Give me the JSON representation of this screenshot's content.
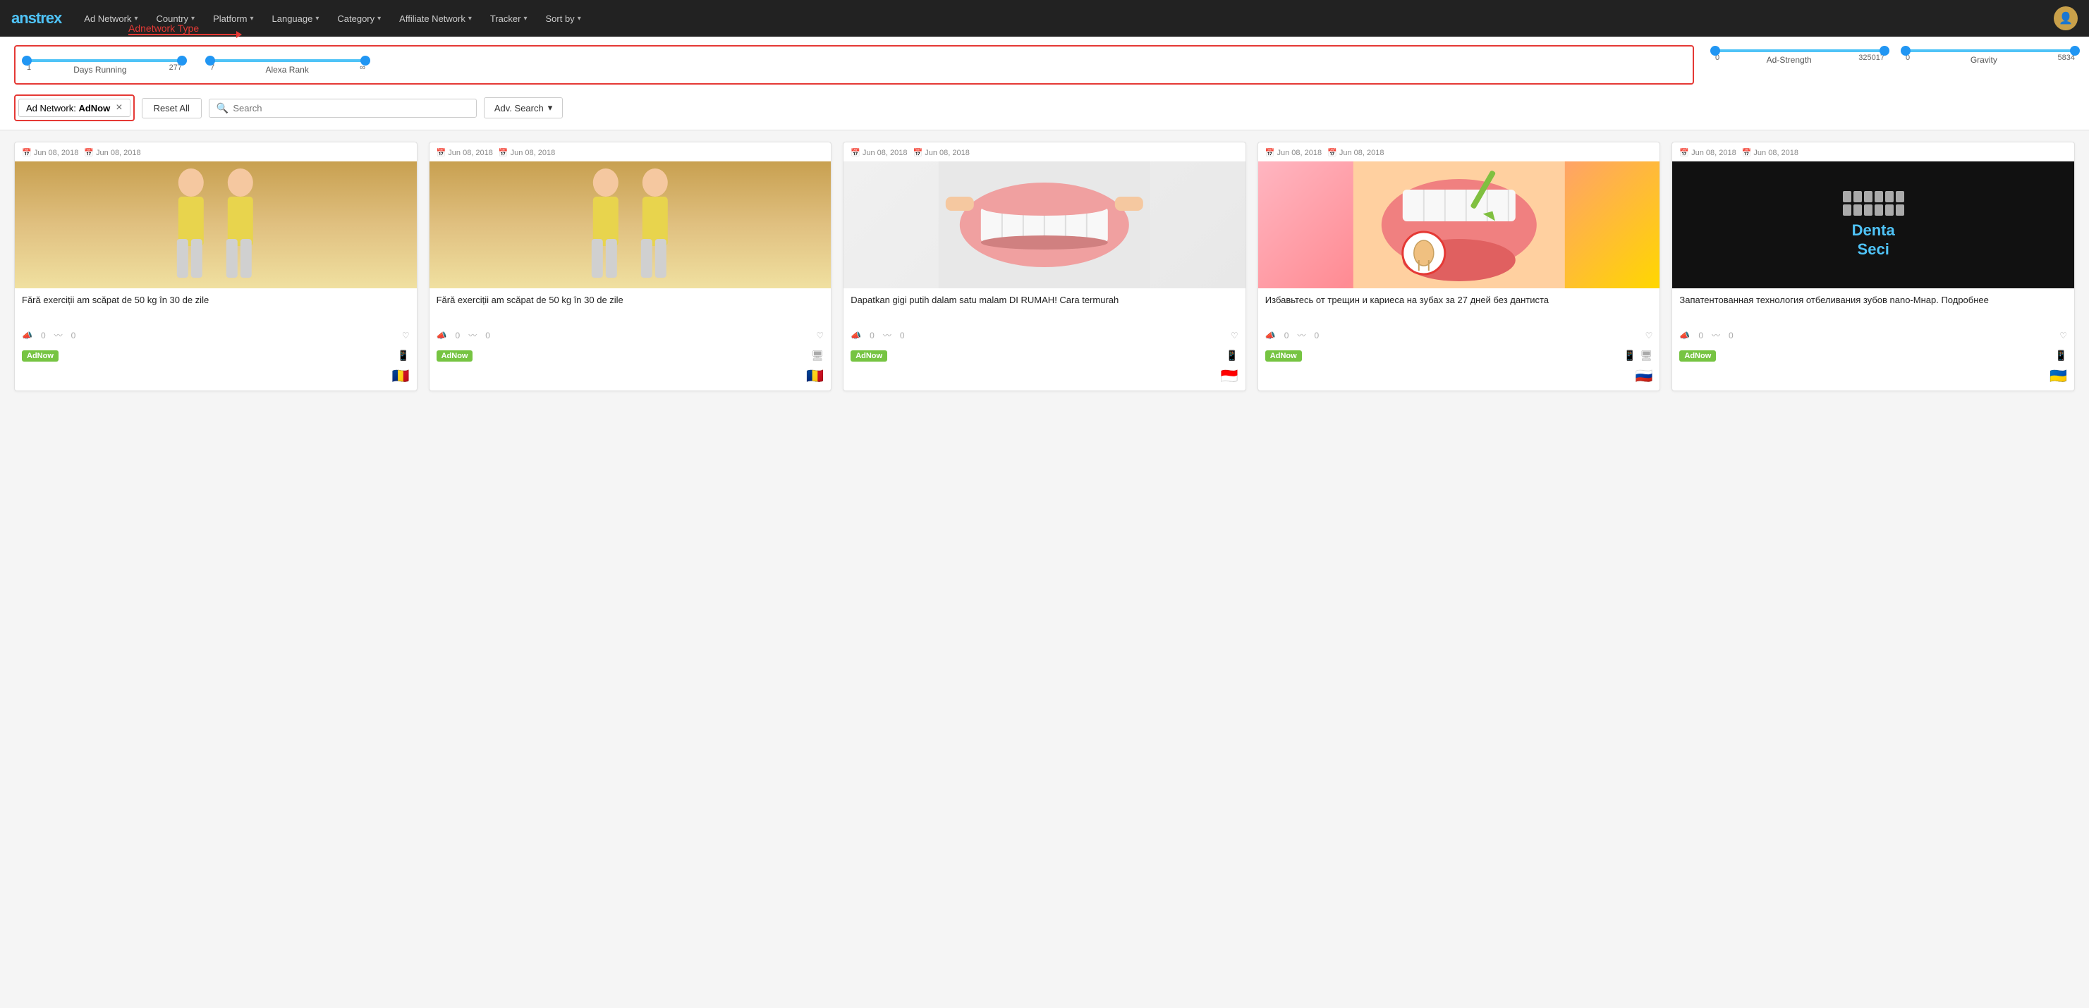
{
  "brand": {
    "name": "anstrex"
  },
  "navbar": {
    "items": [
      {
        "label": "Ad Network",
        "id": "ad-network"
      },
      {
        "label": "Country",
        "id": "country"
      },
      {
        "label": "Platform",
        "id": "platform"
      },
      {
        "label": "Language",
        "id": "language"
      },
      {
        "label": "Category",
        "id": "category"
      },
      {
        "label": "Affiliate Network",
        "id": "affiliate-network"
      },
      {
        "label": "Tracker",
        "id": "tracker"
      },
      {
        "label": "Sort by",
        "id": "sort-by"
      }
    ]
  },
  "filters": {
    "days_running": {
      "label": "Days Running",
      "min": 1,
      "max": 277,
      "current_min": 1,
      "current_max": 277
    },
    "alexa_rank": {
      "label": "Alexa Rank",
      "min": 7,
      "max": "∞",
      "current_min": 7,
      "current_max": "∞"
    },
    "ad_strength": {
      "label": "Ad-Strength",
      "min": 0,
      "max": 325017,
      "current_min": 0,
      "current_max": 325017
    },
    "gravity": {
      "label": "Gravity",
      "min": 0,
      "max": 5834,
      "current_min": 0,
      "current_max": 5834
    },
    "adnetwork_type_label": "Adnetwork Type",
    "active_tag": {
      "prefix": "Ad Network:",
      "value": "AdNow"
    },
    "reset_label": "Reset All",
    "search_placeholder": "Search",
    "adv_search_label": "Adv. Search"
  },
  "cards": [
    {
      "date_start": "Jun 08, 2018",
      "date_end": "Jun 08, 2018",
      "title": "Fără exerciții am scăpat de 50 kg în 30 de zile",
      "image_type": "person_double",
      "network": "AdNow",
      "devices": [
        "mobile"
      ],
      "flag": "🇷🇴",
      "stats_push": "0",
      "stats_trend": "0"
    },
    {
      "date_start": "Jun 08, 2018",
      "date_end": "Jun 08, 2018",
      "title": "Fără exerciții am scăpat de 50 kg în 30 de zile",
      "image_type": "person_double",
      "network": "AdNow",
      "devices": [
        "desktop"
      ],
      "flag": "🇷🇴",
      "stats_push": "0",
      "stats_trend": "0"
    },
    {
      "date_start": "Jun 08, 2018",
      "date_end": "Jun 08, 2018",
      "title": "Dapatkan gigi putih dalam satu malam DI RUMAH! Cara termurah",
      "image_type": "teeth",
      "network": "AdNow",
      "devices": [
        "mobile"
      ],
      "flag": "🇮🇩",
      "stats_push": "0",
      "stats_trend": "0"
    },
    {
      "date_start": "Jun 08, 2018",
      "date_end": "Jun 08, 2018",
      "title": "Избавьтесь от трещин и кариеса на зубах за 27 дней без дантиста",
      "image_type": "tooth_diagram",
      "network": "AdNow",
      "devices": [
        "mobile",
        "desktop"
      ],
      "flag": "🇷🇺",
      "stats_push": "0",
      "stats_trend": "0"
    },
    {
      "date_start": "Jun 08, 2018",
      "date_end": "Jun 08, 2018",
      "title": "Запатентованная технология отбеливания зубов nano-Мнар. Подробнее",
      "image_type": "denta_dark",
      "network": "AdNow",
      "devices": [
        "mobile"
      ],
      "flag": "🇺🇦",
      "stats_push": "0",
      "stats_trend": "0"
    }
  ],
  "icons": {
    "calendar": "📅",
    "caret_down": "▾",
    "search": "🔍",
    "push": "📣",
    "trend": "📈",
    "heart": "♡",
    "mobile": "📱",
    "desktop": "🖥"
  }
}
